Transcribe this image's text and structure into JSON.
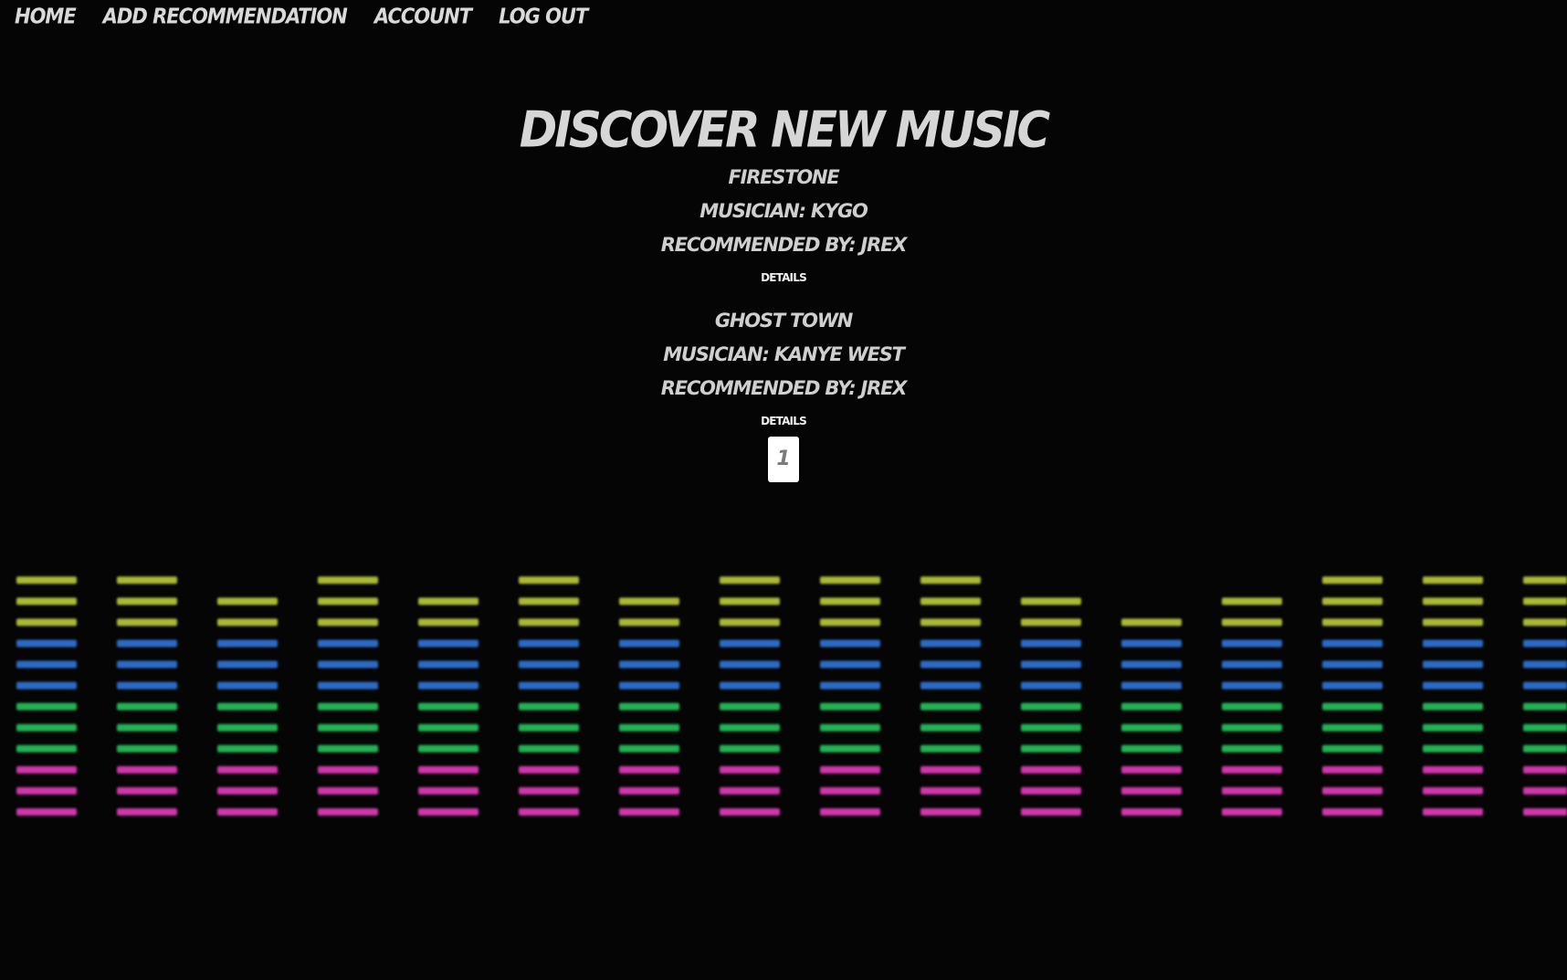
{
  "nav": {
    "home": "Home",
    "add_recommendation": "Add Recommendation",
    "account": "Account",
    "log_out": "Log Out"
  },
  "main": {
    "title": "Discover New Music",
    "recommendations": [
      {
        "song": "Firestone",
        "musician": "Musician: Kygo",
        "recommended_by": "Recommended By: JRex",
        "details_label": "Details"
      },
      {
        "song": "Ghost Town",
        "musician": "Musician: Kanye West",
        "recommended_by": "Recommended By: JRex",
        "details_label": "Details"
      }
    ],
    "pagination": {
      "current_page": "1"
    }
  },
  "background": {
    "colors": {
      "page": "#050505",
      "yellow": "#b8c93a",
      "blue": "#2f74d6",
      "green": "#25c15c",
      "magenta": "#e03bb8"
    },
    "equalizer_band_levels": [
      0.86,
      0.86,
      0.79,
      0.83,
      0.79,
      0.83,
      0.76,
      0.86,
      0.86,
      0.86,
      0.79,
      0.72,
      0.79,
      0.83,
      0.83,
      0.83
    ]
  }
}
